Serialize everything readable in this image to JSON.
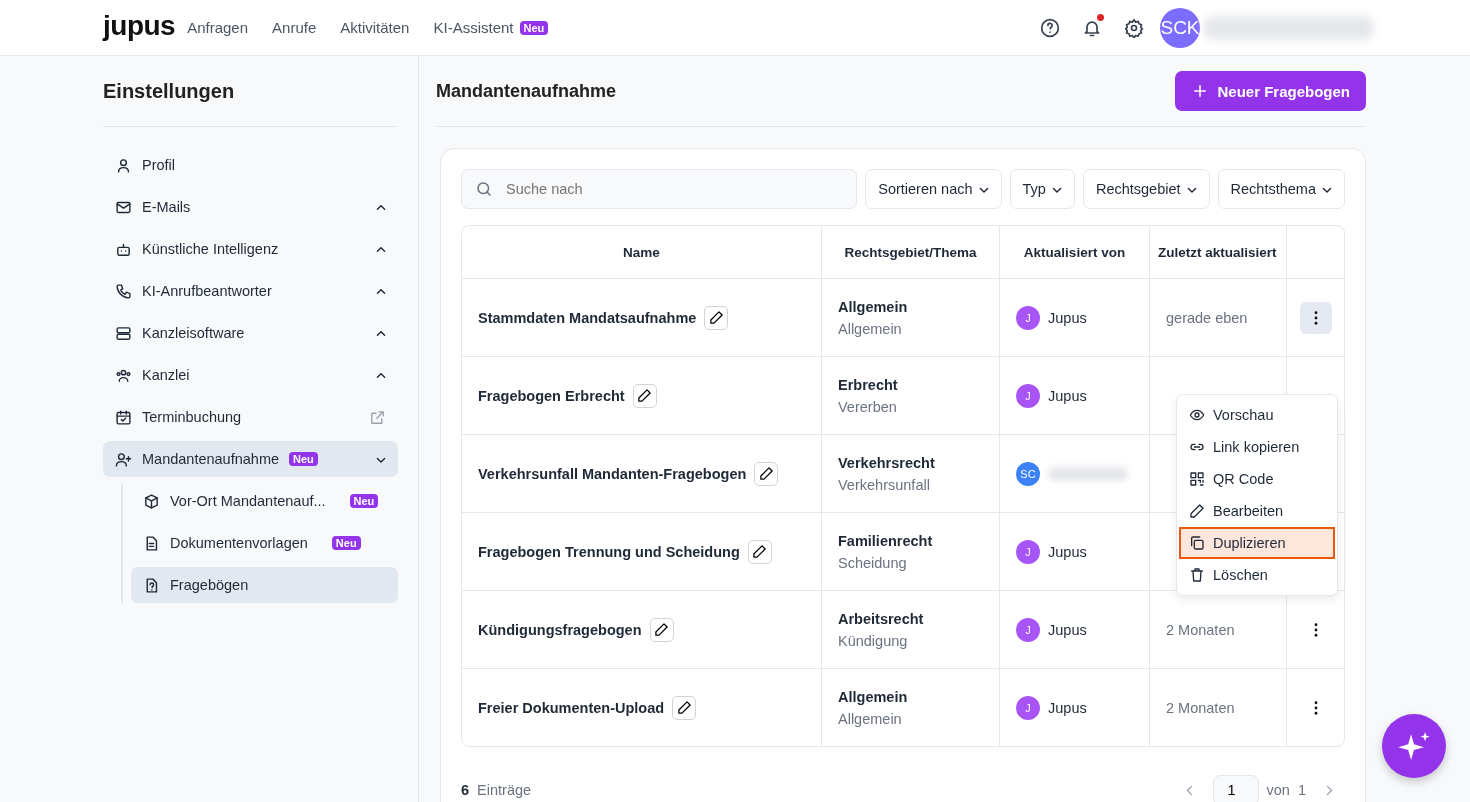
{
  "header": {
    "logo": "jupus",
    "nav": [
      {
        "label": "Anfragen"
      },
      {
        "label": "Anrufe"
      },
      {
        "label": "Aktivitäten"
      },
      {
        "label": "KI-Assistent",
        "badge": "Neu"
      }
    ],
    "notifications_unread": true,
    "avatar": "SCK"
  },
  "sidebar": {
    "title": "Einstellungen",
    "items": [
      {
        "label": "Profil",
        "kind": "plain",
        "selected": false
      },
      {
        "label": "E-Mails",
        "kind": "group",
        "expanded": false,
        "selected": false
      },
      {
        "label": "Künstliche Intelligenz",
        "kind": "group",
        "expanded": false,
        "selected": false
      },
      {
        "label": "KI-Anrufbeantworter",
        "kind": "group",
        "expanded": false,
        "selected": false
      },
      {
        "label": "Kanzleisoftware",
        "kind": "group",
        "expanded": false,
        "selected": false
      },
      {
        "label": "Kanzlei",
        "kind": "group",
        "expanded": false,
        "selected": false
      },
      {
        "label": "Terminbuchung",
        "kind": "external",
        "selected": false
      },
      {
        "label": "Mandantenaufnahme",
        "kind": "group",
        "badge": "Neu",
        "expanded": true,
        "selected": true,
        "children": [
          {
            "label": "Vor-Ort Mandantenauf...",
            "badge": "Neu",
            "selected": false
          },
          {
            "label": "Dokumentenvorlagen",
            "badge": "Neu",
            "selected": false
          },
          {
            "label": "Fragebögen",
            "selected": true
          }
        ]
      }
    ]
  },
  "main": {
    "title": "Mandantenaufnahme",
    "new_button": "Neuer Fragebogen",
    "search": {
      "placeholder": "Suche nach"
    },
    "filters": [
      "Sortieren nach",
      "Typ",
      "Rechtsgebiet",
      "Rechtsthema"
    ],
    "table": {
      "columns": [
        "Name",
        "Rechtsgebiet/Thema",
        "Aktualisiert von",
        "Zuletzt aktualisiert"
      ],
      "rows": [
        {
          "name": "Stammdaten Mandatsaufnahme",
          "area": "Allgemein",
          "topic": "Allgemein",
          "initials": "J",
          "updater": "Jupus",
          "color": "#a855f7",
          "updated": "gerade eben",
          "menu_open": true
        },
        {
          "name": "Fragebogen Erbrecht",
          "area": "Erbrecht",
          "topic": "Vererben",
          "initials": "J",
          "updater": "Jupus",
          "color": "#a855f7",
          "menu_open": false
        },
        {
          "name": "Verkehrsunfall Mandanten-Fragebogen",
          "area": "Verkehrsrecht",
          "topic": "Verkehrsunfall",
          "initials": "SC",
          "color": "#3b82f6",
          "menu_open": false
        },
        {
          "name": "Fragebogen Trennung und Scheidung",
          "area": "Familienrecht",
          "topic": "Scheidung",
          "initials": "J",
          "updater": "Jupus",
          "color": "#a855f7",
          "menu_open": false
        },
        {
          "name": "Kündigungsfragebogen",
          "area": "Arbeitsrecht",
          "topic": "Kündigung",
          "initials": "J",
          "updater": "Jupus",
          "color": "#a855f7",
          "updated": "2 Monaten",
          "menu_open": false
        },
        {
          "name": "Freier Dokumenten-Upload",
          "area": "Allgemein",
          "topic": "Allgemein",
          "initials": "J",
          "updater": "Jupus",
          "color": "#a855f7",
          "updated": "2 Monaten",
          "menu_open": false
        }
      ]
    },
    "menu": [
      {
        "label": "Vorschau",
        "kind": "eye",
        "selected": false
      },
      {
        "label": "Link kopieren",
        "kind": "link",
        "selected": false
      },
      {
        "label": "QR Code",
        "kind": "qr",
        "selected": false
      },
      {
        "label": "Bearbeiten",
        "kind": "pencil",
        "selected": false
      },
      {
        "label": "Duplizieren",
        "kind": "copy",
        "selected": true
      },
      {
        "label": "Löschen",
        "kind": "trash",
        "selected": false
      }
    ],
    "footer": {
      "count": "6",
      "count_label": "Einträge",
      "page": "1",
      "of": "von",
      "pages": "1"
    }
  }
}
